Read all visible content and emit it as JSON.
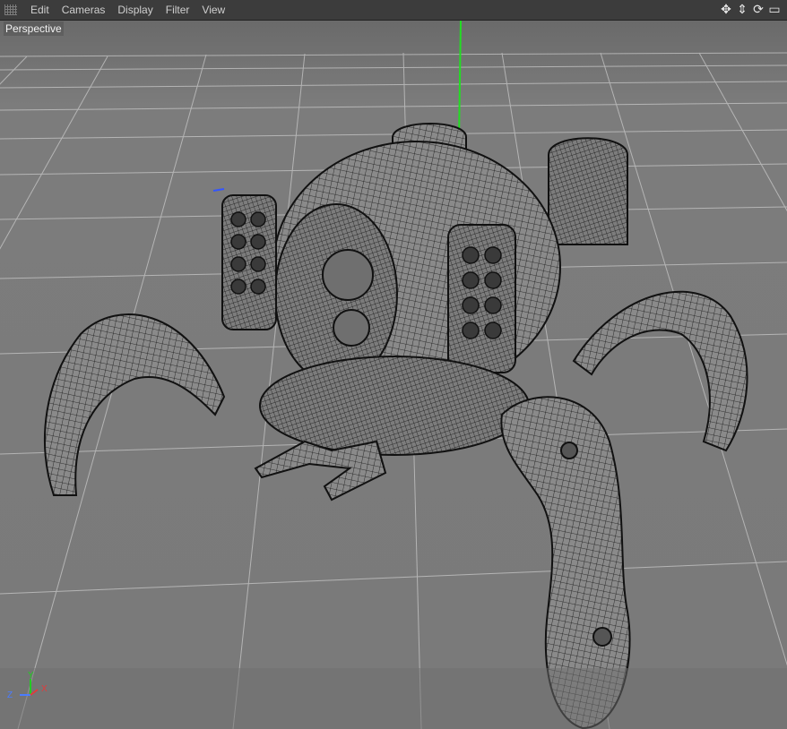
{
  "menubar": {
    "items": [
      "Edit",
      "Cameras",
      "Display",
      "Filter",
      "View"
    ]
  },
  "nav_icons": [
    "move-icon",
    "dolly-icon",
    "rotate-icon",
    "maximize-icon"
  ],
  "viewport": {
    "label": "Perspective",
    "background_color": "#7a7a7a",
    "grid_color": "#c9c9c9",
    "wire_color": "#111111",
    "y_axis_color": "#22dd22"
  },
  "axis_gizmo": {
    "y": "Y",
    "z": "Z",
    "x": "X",
    "y_color": "#22cc22",
    "z_color": "#4a7cff",
    "x_color": "#e23b3b"
  }
}
